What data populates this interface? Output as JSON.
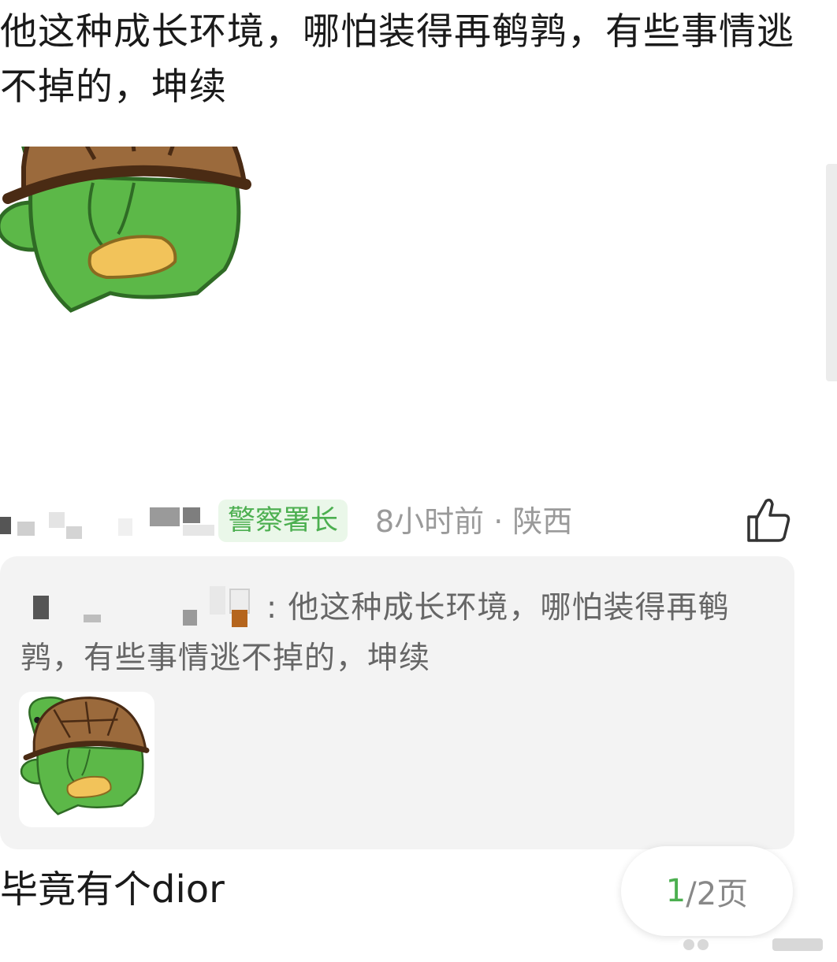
{
  "comment": {
    "text": "他这种成长环境，哪怕装得再鹌鹑，有些事情逃不掉的，坤续",
    "sticker": "turtle-sticker"
  },
  "meta": {
    "badge": "警察署长",
    "time_location": "8小时前 · 陕西",
    "like_icon": "thumbs-up-icon"
  },
  "reply": {
    "text": ": 他这种成长环境，哪怕装得再鹌鹑，有些事情逃不掉的，坤续",
    "sticker": "turtle-sticker"
  },
  "next_comment": {
    "text": "毕竟有个dior"
  },
  "pager": {
    "current": "1",
    "rest": "/2页"
  },
  "colors": {
    "accent_green": "#4caf50",
    "badge_bg": "#eaf7e9",
    "reply_bg": "#f3f3f3",
    "meta_gray": "#9a9a9a"
  }
}
